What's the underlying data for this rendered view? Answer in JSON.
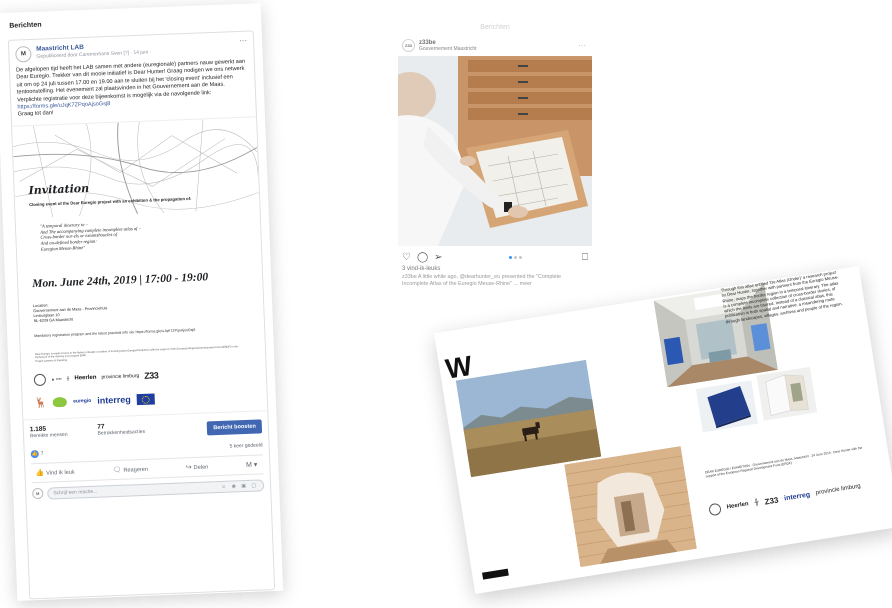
{
  "facebook": {
    "section_title": "Berichten",
    "page_name": "Maastricht LAB",
    "meta": "Gepubliceerd door Caremerhans Sven [?] · 14 juni ·",
    "post_text": "De afgelopen tijd heeft het LAB samen met andere (euregionale) partners nauw gewerkt aan Dear Euregio. Trekker van dit mooie initiatief is Dear Hunter! Graag nodigen we ons netwerk uit om op 24 juli tussen 17.00 en 19.00 aan te sluiten bij het 'closing event' inclusief een tentoonstelling. Het evenement zal plaatsvinden in het Gouvernement aan de Maas. Verplichte registratie voor deze bijeenkomst is mogelijk via de navolgende link:",
    "post_link": "https://forms.gle/uJqK7ZPqoAjsoGsj8",
    "post_end": "Graag tot dan!",
    "invitation": {
      "title": "Invitation",
      "subtitle": "Closing event of the Dear Euregio project with an exhibition & the propagation of:",
      "quote_1": "\"A temporal itinerary to –",
      "quote_2": "And The accompanying complete incomplete atlas of –",
      "quote_3": "Cross-border our-els or extantshoucles of",
      "quote_4": "And on-defined border region:",
      "quote_5": "Euregion Meuse-Rhine\"",
      "date": "Mon. June 24th, 2019 | 17:00 - 19:00",
      "location_label": "Location:",
      "location_1": "Gouvernement aan de Maas - Provinciehuis",
      "location_2": "Limburglaan 10",
      "location_3": "NL-6229 GA Maastricht",
      "registration": "Mandatory registration program and the latest practical info via: https://forms.gle/uJqK7ZPqoAjsoGsj8",
      "fine_print": "Dear Euregio is made in turns to the flanks to Reside a number of Forming Dear Euregio/Peutenfors with the support of the European Regional Development Fund (ERDF) in the framework of the Interreg V-A program EMR",
      "partners_label": "Project partners & financing",
      "logo_heerlen": "Heerlen",
      "logo_provincie": "provincie limburg",
      "logo_z33": "Z33",
      "logo_euregio": "euregio",
      "logo_interreg": "interreg"
    },
    "stats": {
      "reach_value": "1.185",
      "reach_label": "Bereikte mensen",
      "engagement_value": "77",
      "engagement_label": "Betrokkenheidsacties",
      "boost_label": "Bericht boosten"
    },
    "reactions_count": "7",
    "shares": "5 keer gedeeld",
    "actions": {
      "like": "Vind ik leuk",
      "comment": "Reageren",
      "share": "Delen"
    },
    "comment_placeholder": "Schrijf een reactie..."
  },
  "instagram": {
    "top_label": "Berichten",
    "username": "z33be",
    "location": "Gouvernement Maastricht",
    "likes": "3 vind-ik-leuks",
    "caption": "z33be A little while ago, @dearhunter_eu presented the \"Complete Incomplete Atlas of the Euregio Meuse-Rhine\" ... meer"
  },
  "catalogue": {
    "letter": "W",
    "body_text": "Through this atlas entitled 'De Atlas (Onder)' a research project by Dear Hunter, together with partners from the Euregio Meuse-Rhine, maps the border region in a temporal itinerary. The atlas is a complete incomplete collection of cross-border stories, of which the limits are blurred. Instead of a classical atlas, this publication is both spatial and narrative: a meandering route through landscapes, villages, archives and people of the region.",
    "credits": "DEAR EUREGIO / EXHIBITION · Gouvernement aan de Maas, Maastricht · 24 June 2019 · Dear Hunter with the support of the European Regional Development Fund (ERDF)",
    "logo_heerlen": "Heerlen",
    "logo_z33": "Z33",
    "logo_provincie": "provincie limburg",
    "logo_interreg": "interreg"
  }
}
